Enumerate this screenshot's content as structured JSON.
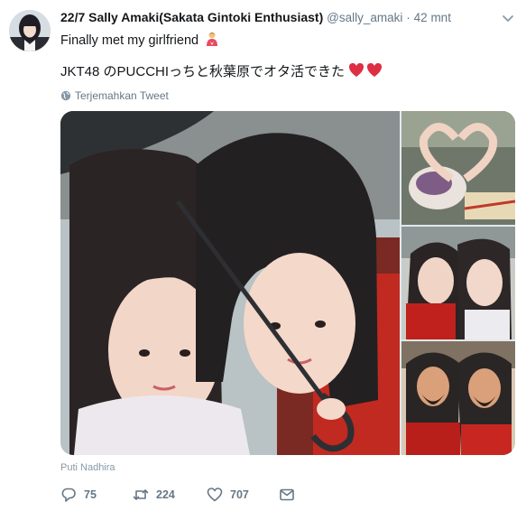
{
  "tweet": {
    "author_name": "22/7 Sally Amaki(Sakata Gintoki Enthusiast)",
    "author_handle": "@sally_amaki",
    "separator": "·",
    "time": "42 mnt",
    "text_line1": "Finally met my girlfriend",
    "text_line2": "JKT48 のPUCCHIっちと秋葉原でオタ活できた",
    "translate_label": "Terjemahkan Tweet",
    "photo_credit": "Puti Nadhira",
    "icons": {
      "avatar": "avatar",
      "caret": "chevron-down-icon",
      "globe": "globe-icon",
      "reply": "reply-icon",
      "retweet": "retweet-icon",
      "like": "heart-icon",
      "dm": "envelope-icon",
      "emoji1": "couple-emoji",
      "emoji2": "red-hearts-emoji"
    }
  },
  "actions": {
    "reply_count": "75",
    "retweet_count": "224",
    "like_count": "707"
  },
  "colors": {
    "name": "#14171a",
    "secondary": "#657786",
    "heart_red": "#e0245e"
  }
}
